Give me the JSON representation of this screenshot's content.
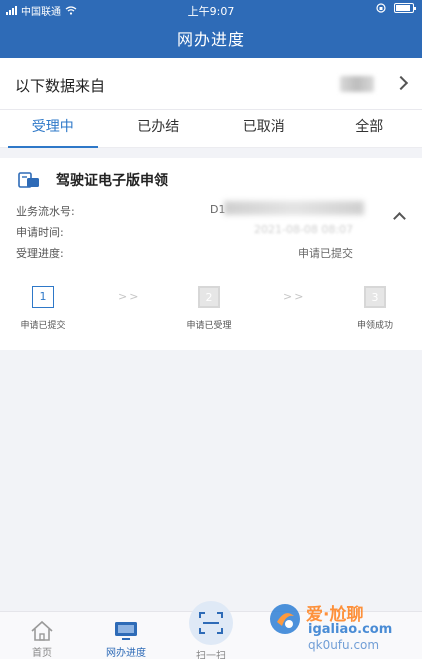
{
  "status_bar": {
    "carrier": "中国联通",
    "time": "上午9:07"
  },
  "header": {
    "title": "网办进度"
  },
  "source": {
    "label": "以下数据来自"
  },
  "tabs": [
    {
      "label": "受理中",
      "active": true
    },
    {
      "label": "已办结",
      "active": false
    },
    {
      "label": "已取消",
      "active": false
    },
    {
      "label": "全部",
      "active": false
    }
  ],
  "card": {
    "title": "驾驶证电子版申领",
    "fields": {
      "serial_label": "业务流水号:",
      "serial_value": "D1",
      "time_label": "申请时间:",
      "time_value": "2021-08-08 08:07",
      "progress_label": "受理进度:",
      "progress_value": "申请已提交"
    },
    "steps": [
      {
        "number": "1",
        "label": "申请已提交",
        "active": true
      },
      {
        "number": "2",
        "label": "申请已受理",
        "active": false
      },
      {
        "number": "3",
        "label": "申领成功",
        "active": false
      }
    ],
    "step_separator": ">>"
  },
  "bottom_nav": [
    {
      "label": "首页",
      "icon": "home-icon"
    },
    {
      "label": "网办进度",
      "icon": "monitor-icon"
    },
    {
      "label": "扫一扫",
      "icon": "scan-icon"
    }
  ],
  "watermark": {
    "brand": "爱·尬聊",
    "url": "igaliao.com",
    "url2": "qk0ufu.com"
  },
  "colors": {
    "primary": "#2e6bb7",
    "accent": "#2e78c8"
  }
}
